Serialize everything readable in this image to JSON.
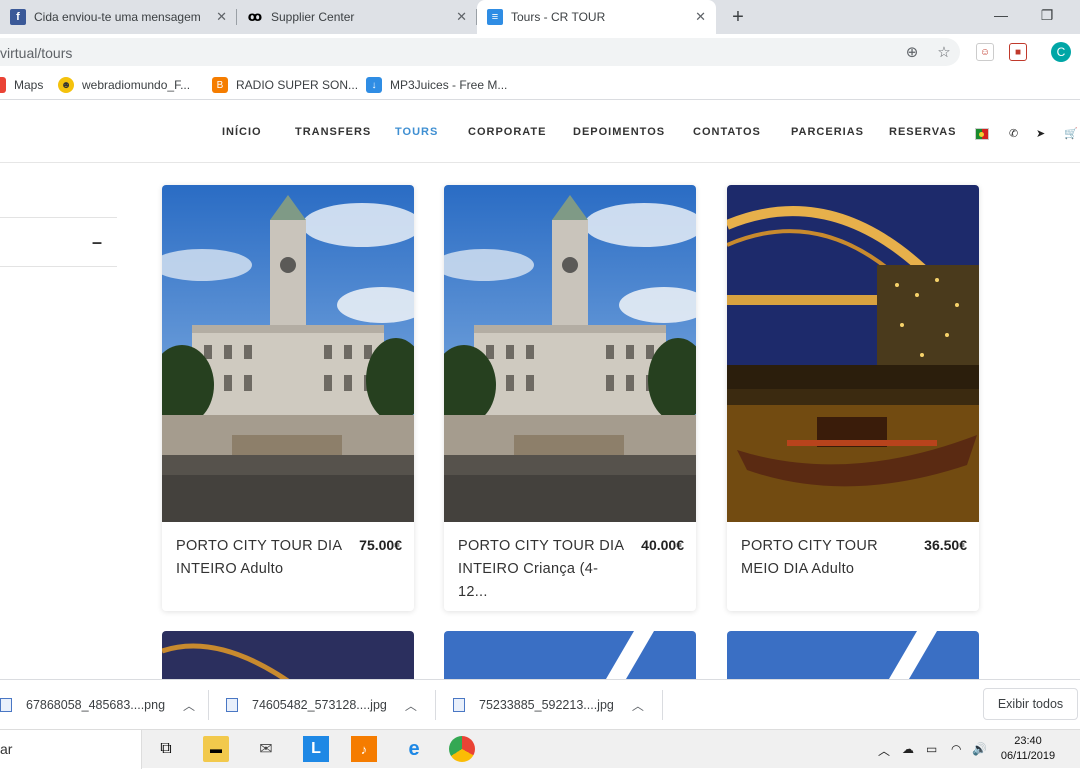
{
  "browser": {
    "tabs": [
      {
        "title": "Cida enviou-te uma mensagem",
        "icon": "facebook-icon"
      },
      {
        "title": "Supplier Center",
        "icon": "tripadvisor-icon"
      },
      {
        "title": "Tours - CR TOUR",
        "icon": "document-icon",
        "active": true
      }
    ],
    "new_tab": "+",
    "url": "virtual/tours",
    "profile_initial": "C",
    "bookmarks": [
      {
        "label": "Maps",
        "icon": "maps-icon"
      },
      {
        "label": "webradiomundo_F...",
        "icon": "smiley-icon"
      },
      {
        "label": "RADIO SUPER SON...",
        "icon": "blogger-icon"
      },
      {
        "label": "MP3Juices - Free M...",
        "icon": "download-icon"
      }
    ]
  },
  "site": {
    "nav": [
      "INÍCIO",
      "TRANSFERS",
      "TOURS",
      "CORPORATE",
      "DEPOIMENTOS",
      "CONTATOS",
      "PARCERIAS",
      "RESERVAS"
    ],
    "active_nav": "TOURS",
    "accent": "#3f8fd2",
    "collapse_symbol": "–"
  },
  "tours": [
    {
      "name": "PORTO CITY TOUR DIA INTEIRO Adulto",
      "price": "75.00€",
      "image": "city-hall-photo"
    },
    {
      "name": "PORTO CITY TOUR DIA INTEIRO Criança (4-12...",
      "price": "40.00€",
      "image": "city-hall-photo"
    },
    {
      "name": "PORTO CITY TOUR MEIO DIA Adulto",
      "price": "36.50€",
      "image": "bridge-night-photo"
    }
  ],
  "downloads": {
    "items": [
      "67868058_485683....png",
      "74605482_573128....jpg",
      "75233885_592213....jpg"
    ],
    "show_all": "Exibir todos"
  },
  "taskbar": {
    "search_text": "ar",
    "time": "23:40",
    "date": "06/11/2019"
  }
}
